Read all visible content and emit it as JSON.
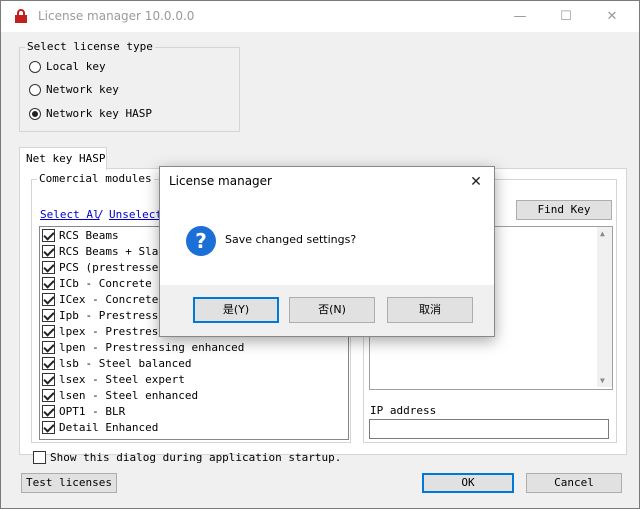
{
  "window": {
    "title": "License manager 10.0.0.0",
    "minimize": "—",
    "maximize": "☐",
    "close": "✕"
  },
  "license_type": {
    "legend": "Select license type",
    "options": [
      "Local key",
      "Network key",
      "Network key HASP"
    ],
    "selected": 2
  },
  "tab": {
    "label": "Net key HASP"
  },
  "modules": {
    "legend": "Comercial modules",
    "select_all": "Select Al",
    "separator": "/",
    "unselect": "Unselect",
    "items": [
      "RCS Beams",
      "RCS Beams + Slabs",
      "PCS (prestressed",
      "ICb - Concrete ba",
      "ICex - Concrete e",
      "Ipb - Prestressin",
      "lpex - Prestressi",
      "lpen - Prestressing enhanced",
      "lsb - Steel balanced",
      "lsex - Steel expert",
      "lsen - Steel enhanced",
      "OPT1 - BLR",
      "Detail Enhanced"
    ]
  },
  "find_key": "Find Key",
  "ip_address": {
    "label": "IP address",
    "value": ""
  },
  "startup_checkbox": "Show this dialog during application startup.",
  "buttons": {
    "test": "Test licenses",
    "ok": "OK",
    "cancel": "Cancel"
  },
  "dialog": {
    "title": "License manager",
    "close": "✕",
    "icon": "?",
    "message": "Save changed settings?",
    "yes": "是(Y)",
    "no": "否(N)",
    "cancel": "取消"
  }
}
